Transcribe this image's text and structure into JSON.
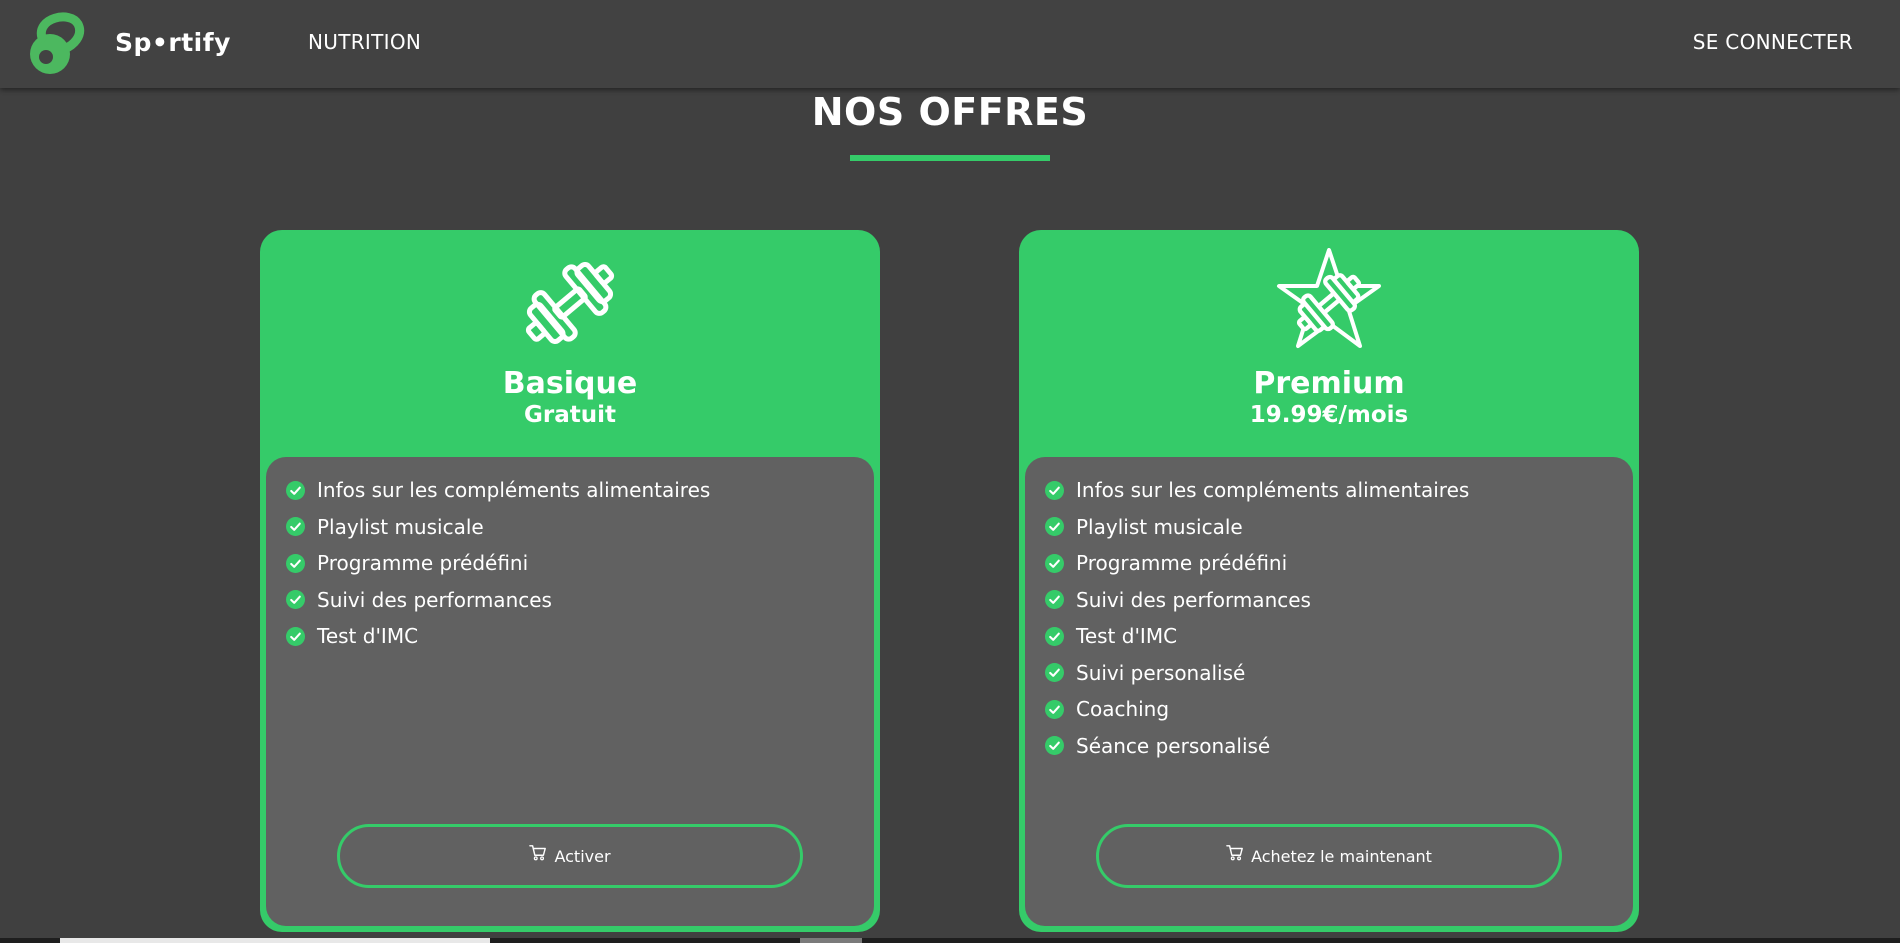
{
  "header": {
    "brand": "Sp•rtify",
    "nav_nutrition": "NUTRITION",
    "nav_login": "SE CONNECTER"
  },
  "section": {
    "title": "NOS OFFRES"
  },
  "colors": {
    "accent": "#35cb69",
    "background": "#404040",
    "card_body": "#616161"
  },
  "offers": [
    {
      "icon": "dumbbell-icon",
      "name": "Basique",
      "price": "Gratuit",
      "features": [
        "Infos sur les compléments alimentaires",
        "Playlist musicale",
        "Programme prédéfini",
        "Suivi des performances",
        "Test d'IMC"
      ],
      "button_icon": "cart-icon",
      "button_label": "Activer"
    },
    {
      "icon": "star-dumbbell-icon",
      "name": "Premium",
      "price": "19.99€/mois",
      "features": [
        "Infos sur les compléments alimentaires",
        "Playlist musicale",
        "Programme prédéfini",
        "Suivi des performances",
        "Test d'IMC",
        "Suivi personalisé",
        "Coaching",
        "Séance personalisé"
      ],
      "button_icon": "cart-icon",
      "button_label": "Achetez le maintenant"
    }
  ]
}
